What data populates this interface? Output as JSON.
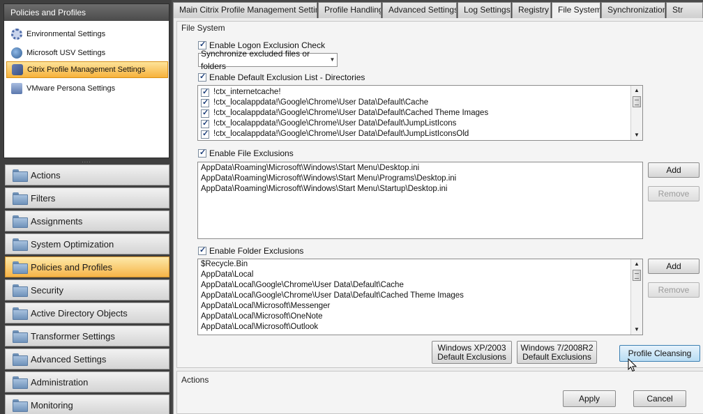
{
  "sidebar": {
    "tree_title": "Policies and Profiles",
    "tree_items": [
      {
        "label": "Environmental Settings",
        "icon": "gear-icon"
      },
      {
        "label": "Microsoft USV Settings",
        "icon": "usv-icon"
      },
      {
        "label": "Citrix Profile Management Settings",
        "icon": "citrix-icon"
      },
      {
        "label": "VMware Persona Settings",
        "icon": "vmware-icon"
      }
    ],
    "splitter": "....",
    "nav_items": [
      {
        "label": "Actions"
      },
      {
        "label": "Filters"
      },
      {
        "label": "Assignments"
      },
      {
        "label": "System Optimization"
      },
      {
        "label": "Policies and Profiles"
      },
      {
        "label": "Security"
      },
      {
        "label": "Active Directory Objects"
      },
      {
        "label": "Transformer Settings"
      },
      {
        "label": "Advanced Settings"
      },
      {
        "label": "Administration"
      },
      {
        "label": "Monitoring"
      }
    ]
  },
  "tabs": [
    {
      "label": "Main Citrix Profile Management Settings"
    },
    {
      "label": "Profile Handling"
    },
    {
      "label": "Advanced Settings"
    },
    {
      "label": "Log Settings"
    },
    {
      "label": "Registry"
    },
    {
      "label": "File System"
    },
    {
      "label": "Synchronization"
    },
    {
      "label": "Str"
    }
  ],
  "file_system": {
    "title": "File System",
    "logon_exclusion_check": {
      "label": "Enable Logon Exclusion Check",
      "checked": true
    },
    "logon_exclusion_mode": {
      "value": "Synchronize excluded files or folders"
    },
    "default_exclusion_dirs": {
      "label": "Enable Default Exclusion List - Directories",
      "checked": true,
      "items": [
        "!ctx_internetcache!",
        "!ctx_localappdata!\\Google\\Chrome\\User Data\\Default\\Cache",
        "!ctx_localappdata!\\Google\\Chrome\\User Data\\Default\\Cached Theme Images",
        "!ctx_localappdata!\\Google\\Chrome\\User Data\\Default\\JumpListIcons",
        "!ctx_localappdata!\\Google\\Chrome\\User Data\\Default\\JumpListIconsOld"
      ]
    },
    "file_exclusions": {
      "label": "Enable File Exclusions",
      "checked": true,
      "items": [
        "AppData\\Roaming\\Microsoft\\Windows\\Start Menu\\Desktop.ini",
        "AppData\\Roaming\\Microsoft\\Windows\\Start Menu\\Programs\\Desktop.ini",
        "AppData\\Roaming\\Microsoft\\Windows\\Start Menu\\Startup\\Desktop.ini"
      ],
      "add_label": "Add",
      "remove_label": "Remove"
    },
    "folder_exclusions": {
      "label": "Enable Folder Exclusions",
      "checked": true,
      "items": [
        "$Recycle.Bin",
        "AppData\\Local",
        "AppData\\Local\\Google\\Chrome\\User Data\\Default\\Cache",
        "AppData\\Local\\Google\\Chrome\\User Data\\Default\\Cached Theme Images",
        "AppData\\Local\\Microsoft\\Messenger",
        "AppData\\Local\\Microsoft\\OneNote",
        "AppData\\Local\\Microsoft\\Outlook"
      ],
      "add_label": "Add",
      "remove_label": "Remove"
    },
    "xp_defaults": {
      "line1": "Windows XP/2003",
      "line2": "Default Exclusions"
    },
    "win7_defaults": {
      "line1": "Windows 7/2008R2",
      "line2": "Default Exclusions"
    },
    "profile_cleansing": "Profile Cleansing"
  },
  "actions_bar": {
    "title": "Actions",
    "apply": "Apply",
    "cancel": "Cancel"
  }
}
